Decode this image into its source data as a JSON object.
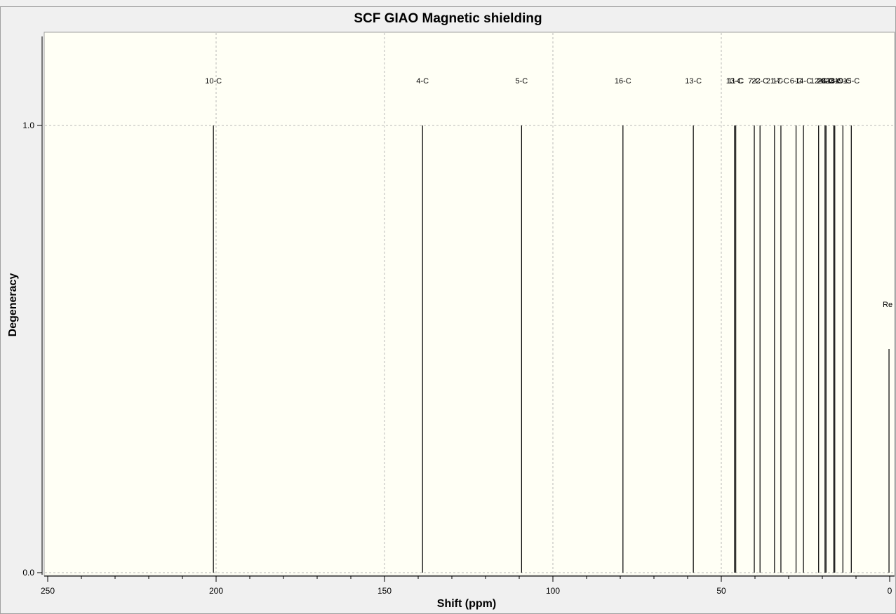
{
  "chart_data": {
    "type": "stick-spectrum",
    "title": "SCF GIAO Magnetic shielding",
    "xlabel": "Shift (ppm)",
    "ylabel": "Degeneracy",
    "xlim": [
      250,
      0
    ],
    "ylim": [
      0.0,
      1.2
    ],
    "x_ticks": [
      "250",
      "200",
      "150",
      "100",
      "50",
      "0"
    ],
    "y_ticks": [
      "0.0",
      "1.0"
    ],
    "grid": true,
    "background": "#fffff5",
    "line_color": "#000000",
    "peaks": [
      {
        "label": "10-C",
        "x": 200.8,
        "y": 1.0
      },
      {
        "label": "4-C",
        "x": 138.7,
        "y": 1.0
      },
      {
        "label": "5-C",
        "x": 109.3,
        "y": 1.0
      },
      {
        "label": "16-C",
        "x": 79.2,
        "y": 1.0
      },
      {
        "label": "13-C",
        "x": 58.3,
        "y": 1.0
      },
      {
        "label": "13-C",
        "x": 46.1,
        "y": 1.0
      },
      {
        "label": "11-C",
        "x": 45.7,
        "y": 1.0
      },
      {
        "label": "7-C",
        "x": 40.2,
        "y": 1.0
      },
      {
        "label": "22-C",
        "x": 38.5,
        "y": 1.0
      },
      {
        "label": "21-C",
        "x": 34.2,
        "y": 1.0
      },
      {
        "label": "17-C",
        "x": 32.3,
        "y": 1.0
      },
      {
        "label": "6-C",
        "x": 27.8,
        "y": 1.0
      },
      {
        "label": "14-C",
        "x": 25.6,
        "y": 1.0
      },
      {
        "label": "12-C",
        "x": 21.1,
        "y": 1.0
      },
      {
        "label": "20-C",
        "x": 19.2,
        "y": 1.0
      },
      {
        "label": "24-C",
        "x": 18.9,
        "y": 1.0
      },
      {
        "label": "23-C",
        "x": 16.6,
        "y": 1.0
      },
      {
        "label": "18-C",
        "x": 16.3,
        "y": 1.0
      },
      {
        "label": "19-C",
        "x": 13.9,
        "y": 1.0
      },
      {
        "label": "15-C",
        "x": 11.4,
        "y": 1.0
      },
      {
        "label": "Re",
        "x": 0.2,
        "y": 0.5
      }
    ]
  }
}
